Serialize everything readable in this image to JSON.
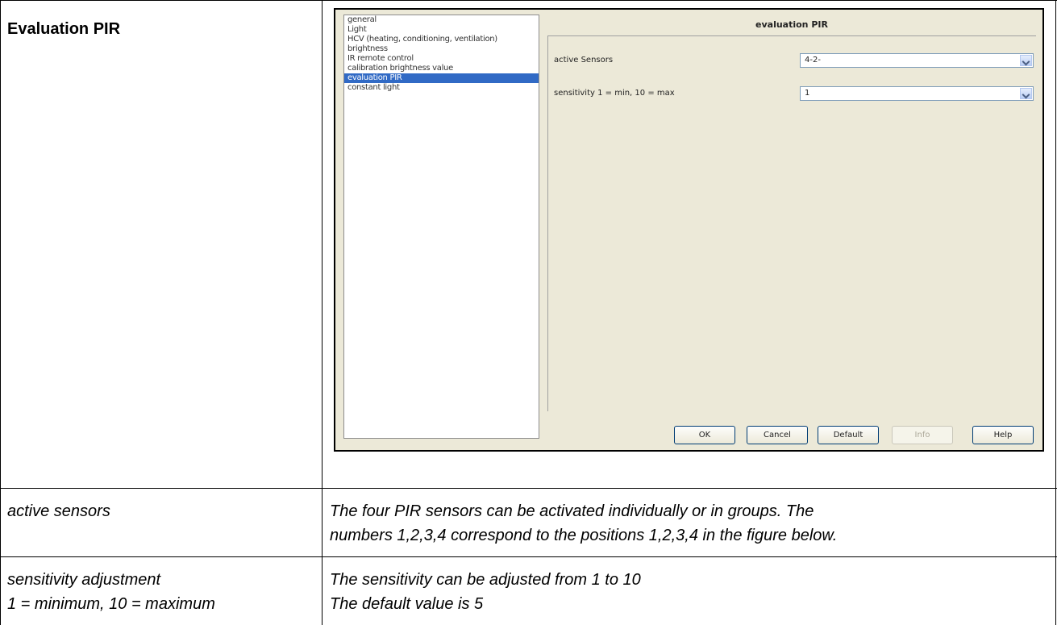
{
  "table": {
    "header_cell": "Evaluation PIR",
    "rows": [
      {
        "term": [
          "active sensors"
        ],
        "description": [
          "The four PIR sensors can be activated individually or in groups.  The",
          "numbers 1,2,3,4 correspond to the positions 1,2,3,4 in the figure below."
        ]
      },
      {
        "term": [
          "sensitivity adjustment",
          "1 = minimum, 10 = maximum"
        ],
        "description": [
          "The sensitivity can be adjusted from 1 to 10",
          "The default value is 5"
        ]
      }
    ]
  },
  "dialog": {
    "nav_items": [
      "general",
      "Light",
      "HCV (heating, conditioning, ventilation)",
      "brightness",
      "IR remote control",
      "calibration brightness value",
      "evaluation PIR",
      "constant light"
    ],
    "selected_item": "evaluation PIR",
    "panel_title": "evaluation PIR",
    "params": [
      {
        "label": "active Sensors",
        "value": "4-2-"
      },
      {
        "label": "sensitivity 1 = min, 10 = max",
        "value": "1"
      }
    ],
    "buttons": {
      "ok": "OK",
      "cancel": "Cancel",
      "default": "Default",
      "info": "Info",
      "help": "Help"
    },
    "colors": {
      "background": "#ece9d8",
      "selection": "#316ac5"
    }
  }
}
